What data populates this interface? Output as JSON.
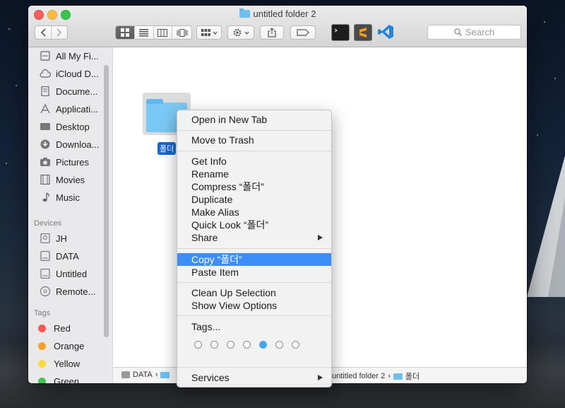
{
  "window": {
    "title": "untitled folder 2"
  },
  "toolbar": {
    "search_placeholder": "Search",
    "apps": [
      "terminal-app-icon",
      "sublime-text-app-icon",
      "vscode-app-icon"
    ]
  },
  "sidebar": {
    "favorites": [
      {
        "label": "All My Fi...",
        "icon": "all-files-icon"
      },
      {
        "label": "iCloud D...",
        "icon": "cloud-icon"
      },
      {
        "label": "Docume...",
        "icon": "documents-icon"
      },
      {
        "label": "Applicati...",
        "icon": "applications-icon"
      },
      {
        "label": "Desktop",
        "icon": "desktop-icon"
      },
      {
        "label": "Downloa...",
        "icon": "downloads-icon"
      },
      {
        "label": "Pictures",
        "icon": "camera-icon"
      },
      {
        "label": "Movies",
        "icon": "film-icon"
      },
      {
        "label": "Music",
        "icon": "music-note-icon"
      }
    ],
    "devices_header": "Devices",
    "devices": [
      {
        "label": "JH"
      },
      {
        "label": "DATA"
      },
      {
        "label": "Untitled"
      },
      {
        "label": "Remote..."
      }
    ],
    "tags_header": "Tags",
    "tags": [
      {
        "label": "Red",
        "color": "#fc5753"
      },
      {
        "label": "Orange",
        "color": "#fd9f2e"
      },
      {
        "label": "Yellow",
        "color": "#fdd93c"
      },
      {
        "label": "Green",
        "color": "#3fc74b"
      }
    ]
  },
  "content": {
    "item_label": "폴더"
  },
  "pathbar": {
    "first": "DATA",
    "right_folder": "untitled folder 2",
    "last": "폴더"
  },
  "context_menu": {
    "open_new_tab": "Open in New Tab",
    "move_to_trash": "Move to Trash",
    "get_info": "Get Info",
    "rename": "Rename",
    "compress": "Compress “폴더”",
    "duplicate": "Duplicate",
    "make_alias": "Make Alias",
    "quick_look": "Quick Look “폴더”",
    "share": "Share",
    "copy": "Copy “폴더”",
    "paste": "Paste Item",
    "clean_up": "Clean Up Selection",
    "show_view_options": "Show View Options",
    "tags": "Tags...",
    "tag_colors_selected_index": 4,
    "services": "Services"
  }
}
